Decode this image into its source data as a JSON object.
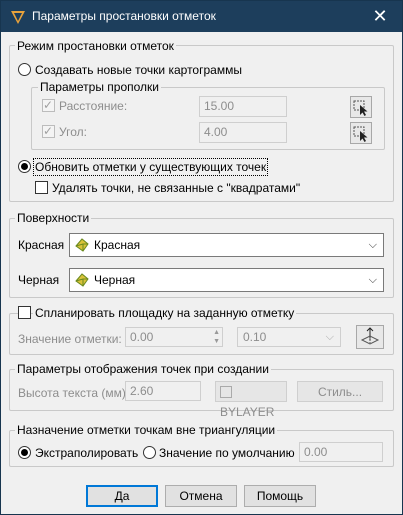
{
  "window": {
    "title": "Параметры простановки отметок",
    "close_label": "✕"
  },
  "mode_group": {
    "title": "Режим простановки отметок",
    "create_option": "Создавать новые точки картограммы",
    "fill_params": {
      "title": "Параметры прополки",
      "distance_label": "Расстояние:",
      "distance_value": "15.00",
      "angle_label": "Угол:",
      "angle_value": "4.00"
    },
    "update_option": "Обновить отметки у существующих точек",
    "delete_option": "Удалять точки, не связанные с \"квадратами\""
  },
  "surfaces_group": {
    "title": "Поверхности",
    "red_label": "Красная",
    "red_value": "Красная",
    "black_label": "Черная",
    "black_value": "Черная"
  },
  "plan_group": {
    "checkbox_label": "Спланировать площадку на заданную отметку",
    "value_label": "Значение отметки:",
    "value": "0.00",
    "step_value": "0.10"
  },
  "display_group": {
    "title": "Параметры отображения точек при создании",
    "text_height_label": "Высота текста (мм):",
    "text_height_value": "2.60",
    "color_label": "BYLAYER",
    "style_label": "Стиль..."
  },
  "assign_group": {
    "title": "Назначение отметки точкам вне триангуляции",
    "extrapolate_option": "Экстраполировать",
    "default_option": "Значение по умолчанию",
    "default_value": "0.00"
  },
  "buttons": {
    "ok": "Да",
    "cancel": "Отмена",
    "help": "Помощь"
  }
}
